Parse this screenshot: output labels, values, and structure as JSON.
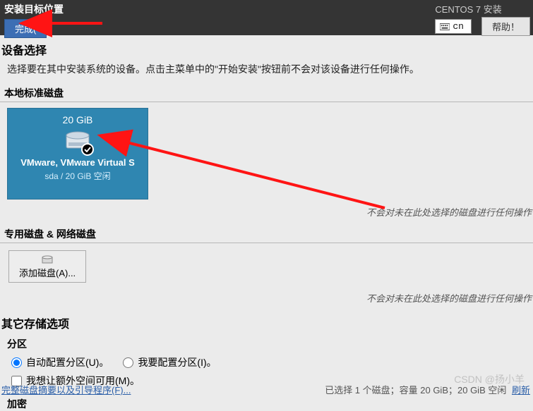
{
  "header": {
    "title": "安装目标位置",
    "done_label": "完成(",
    "distro": "CENTOS 7 安装",
    "keyboard": "cn",
    "help_label": "帮助！"
  },
  "device_select": {
    "heading": "设备选择",
    "description": "选择要在其中安装系统的设备。点击主菜单中的\"开始安装\"按钮前不会对该设备进行任何操作。"
  },
  "local_disks": {
    "heading": "本地标准磁盘",
    "disk": {
      "size": "20 GiB",
      "name": "VMware, VMware Virtual S",
      "sub": "sda    /    20 GiB 空闲"
    },
    "note": "不会对未在此处选择的磁盘进行任何操作"
  },
  "special_disks": {
    "heading": "专用磁盘 & 网络磁盘",
    "add_label": "添加磁盘(A)...",
    "note": "不会对未在此处选择的磁盘进行任何操作"
  },
  "storage": {
    "heading": "其它存储选项",
    "partition_label": "分区",
    "auto_label": "自动配置分区(U)。",
    "manual_label": "我要配置分区(I)。",
    "extra_space_label": "我想让额外空间可用(M)。",
    "encrypt_label": "加密"
  },
  "footer": {
    "summary_link": "完整磁盘摘要以及引导程序(F)...",
    "status_text": "已选择 1 个磁盘；容量 20 GiB；20 GiB 空闲",
    "refresh_link": "刷新"
  },
  "watermark": "CSDN @扬小羊"
}
